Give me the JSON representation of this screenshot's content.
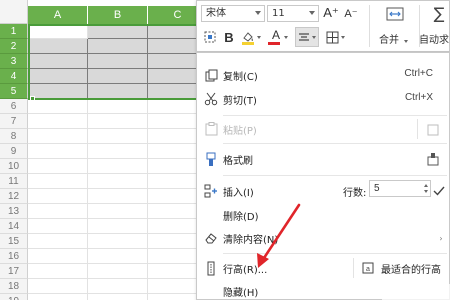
{
  "sheet": {
    "columns": [
      "A",
      "B",
      "C"
    ],
    "rows": [
      "1",
      "2",
      "3",
      "4",
      "5",
      "6",
      "7",
      "8",
      "9",
      "10",
      "11",
      "12",
      "13",
      "14",
      "15",
      "16",
      "17",
      "18",
      "19"
    ],
    "selected_rows": 5,
    "colors": {
      "header_selected": "#6ab04c",
      "selection_border": "#4a9c3a",
      "selected_fill": "#d9d9d9"
    }
  },
  "toolbar": {
    "font_name": "宋体",
    "font_size": "11",
    "grow_font_icon": "A⁺",
    "shrink_font_icon": "A⁻",
    "bold_label": "B",
    "font_color_label": "A",
    "merge_label": "合并",
    "autosum_label": "自动求",
    "icons": [
      "format-painter-icon",
      "fill-color-icon",
      "align-center-icon",
      "border-icon",
      "merge-cells-icon",
      "sum-icon"
    ]
  },
  "menu": {
    "copy": {
      "label": "复制(C)",
      "shortcut": "Ctrl+C"
    },
    "cut": {
      "label": "剪切(T)",
      "shortcut": "Ctrl+X"
    },
    "paste": {
      "label": "粘贴(P)"
    },
    "format_painter": {
      "label": "格式刷"
    },
    "insert": {
      "label": "插入(I)",
      "rows_label": "行数:",
      "rows_value": "5"
    },
    "delete": {
      "label": "删除(D)"
    },
    "clear": {
      "label": "清除内容(N)"
    },
    "row_height": {
      "label": "行高(R)...",
      "best_fit_label": "最适合的行高"
    },
    "hide": {
      "label": "隐藏(H)"
    }
  },
  "colors": {
    "annotation_arrow": "#e0252a"
  }
}
